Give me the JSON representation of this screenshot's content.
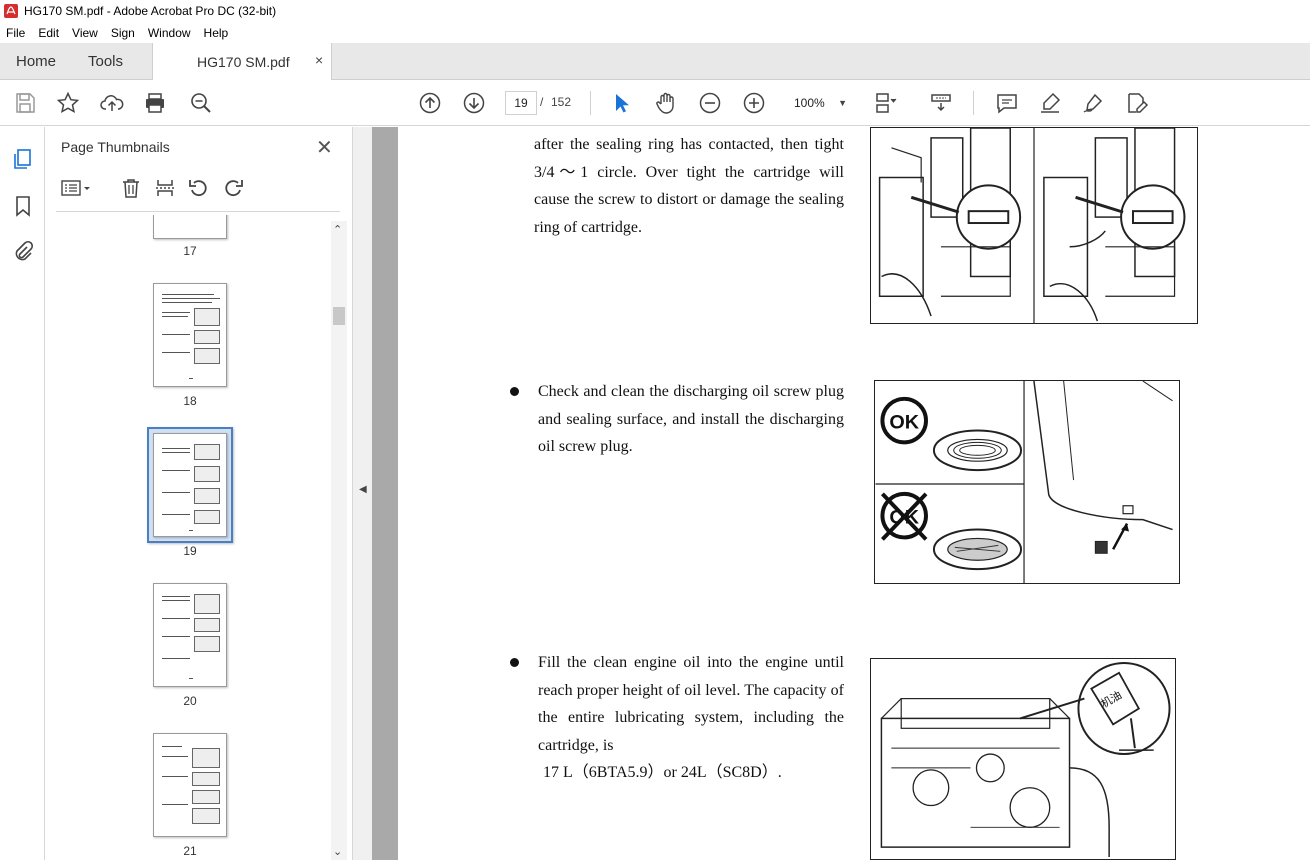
{
  "window": {
    "title": "HG170 SM.pdf - Adobe Acrobat Pro DC (32-bit)"
  },
  "menu": [
    "File",
    "Edit",
    "View",
    "Sign",
    "Window",
    "Help"
  ],
  "tabs": {
    "home": "Home",
    "tools": "Tools",
    "document": "HG170 SM.pdf",
    "close": "×"
  },
  "toolbar": {
    "current_page": "19",
    "separator": "/",
    "total_pages": "152",
    "zoom": "100%"
  },
  "thumbnails_panel": {
    "title": "Page Thumbnails",
    "close": "✕",
    "pages": [
      {
        "label": "17"
      },
      {
        "label": "18"
      },
      {
        "label": "19",
        "selected": true
      },
      {
        "label": "20"
      },
      {
        "label": "21"
      }
    ]
  },
  "document": {
    "para1": "after the sealing ring has contacted, then tight 3/4～1 circle. Over tight the cartridge will cause the screw to distort or damage the sealing ring of cartridge.",
    "para2": "Check and clean the discharging oil screw plug and sealing surface, and install the discharging oil screw plug.",
    "para3_line1": "Fill the clean engine oil into the engine until reach proper height of oil level. The capacity of the entire lubricating system, including the cartridge, is",
    "para3_line2": "17 L（6BTA5.9）or 24L（SC8D）.",
    "fig_ok_label": "OK",
    "fig_oil_label": "机油"
  },
  "colors": {
    "accent": "#4a7fc1",
    "pointer_tool": "#1a73d8",
    "doc_background": "#a9a9a9"
  }
}
